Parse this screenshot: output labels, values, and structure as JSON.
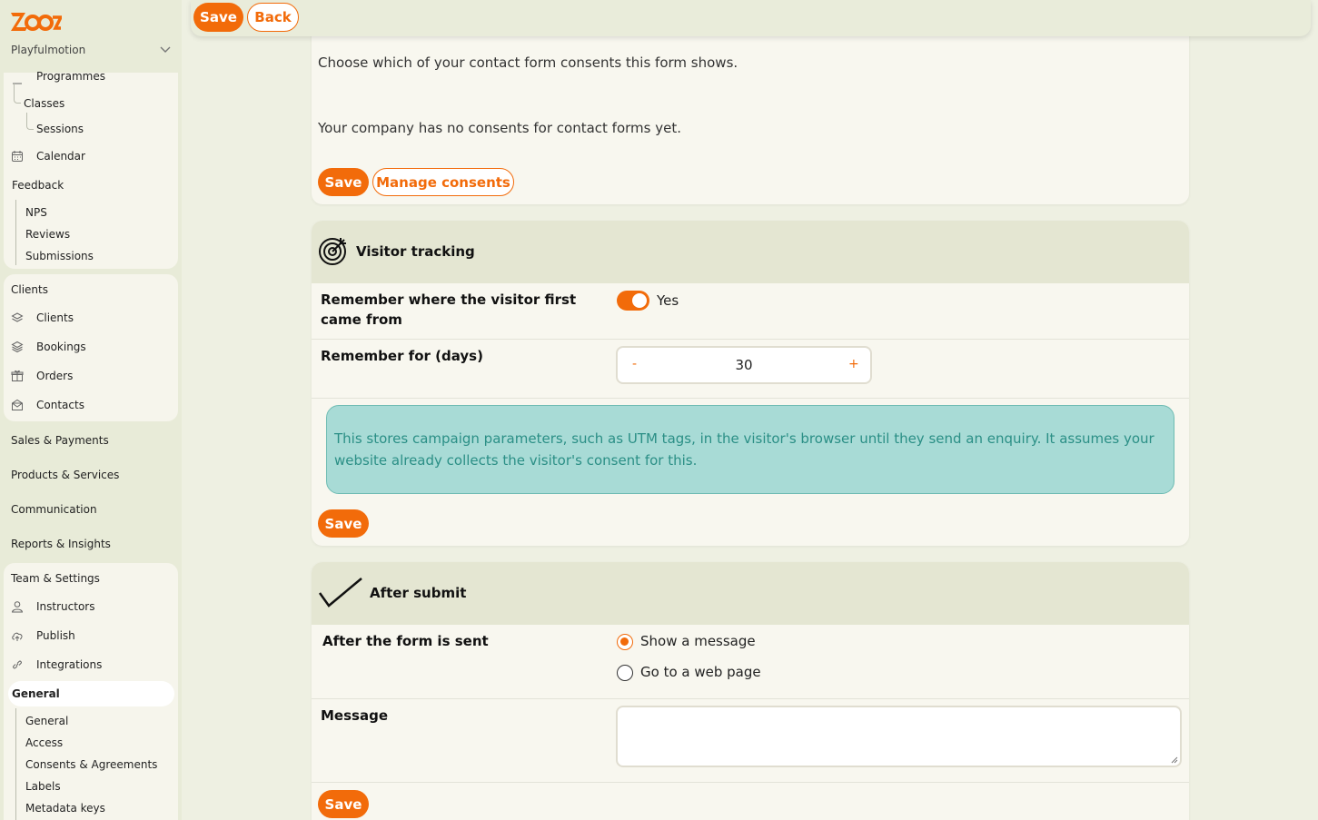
{
  "sidebar": {
    "company": "Playfulmotion",
    "items": [
      {
        "label": "Programmes",
        "icon": "programmes-icon"
      },
      {
        "label": "Classes"
      },
      {
        "label": "Sessions"
      },
      {
        "label": "Calendar",
        "icon": "calendar-icon"
      },
      {
        "label": "Feedback"
      },
      {
        "label": "NPS"
      },
      {
        "label": "Reviews"
      },
      {
        "label": "Submissions"
      },
      {
        "label": "Clients"
      },
      {
        "label": "Clients",
        "icon": "clients-icon"
      },
      {
        "label": "Bookings",
        "icon": "bookings-icon"
      },
      {
        "label": "Orders",
        "icon": "orders-icon"
      },
      {
        "label": "Contacts",
        "icon": "contacts-icon"
      },
      {
        "label": "Sales & Payments"
      },
      {
        "label": "Products & Services"
      },
      {
        "label": "Communication"
      },
      {
        "label": "Reports & Insights"
      },
      {
        "label": "Team & Settings"
      },
      {
        "label": "Instructors",
        "icon": "user-icon"
      },
      {
        "label": "Publish",
        "icon": "cloud-upload-icon"
      },
      {
        "label": "Integrations",
        "icon": "link-icon"
      },
      {
        "label": "General"
      },
      {
        "label": "General"
      },
      {
        "label": "Access"
      },
      {
        "label": "Consents & Agreements"
      },
      {
        "label": "Labels"
      },
      {
        "label": "Metadata keys"
      }
    ]
  },
  "topbar": {
    "save_label": "Save",
    "back_label": "Back"
  },
  "consents": {
    "description": "Choose which of your contact form consents this form shows.",
    "empty_text": "Your company has no consents for contact forms yet.",
    "save_label": "Save",
    "manage_label": "Manage consents"
  },
  "tracking": {
    "title": "Visitor tracking",
    "remember_label": "Remember where the visitor first came from",
    "toggle_on": true,
    "toggle_text": "Yes",
    "days_label": "Remember for (days)",
    "minus": "-",
    "plus": "+",
    "days_value": "30",
    "info": "This stores campaign parameters, such as UTM tags, in the visitor's browser until they send an enquiry. It assumes your website already collects the visitor's consent for this.",
    "save_label": "Save"
  },
  "after_submit": {
    "title": "After submit",
    "sent_label": "After the form is sent",
    "options": [
      {
        "label": "Show a message",
        "selected": true
      },
      {
        "label": "Go to a web page",
        "selected": false
      }
    ],
    "message_label": "Message",
    "message_value": "",
    "save_label": "Save"
  },
  "colors": {
    "accent": "#f26b0a",
    "info_bg": "#a8dbd6",
    "info_text": "#2b8f86"
  }
}
